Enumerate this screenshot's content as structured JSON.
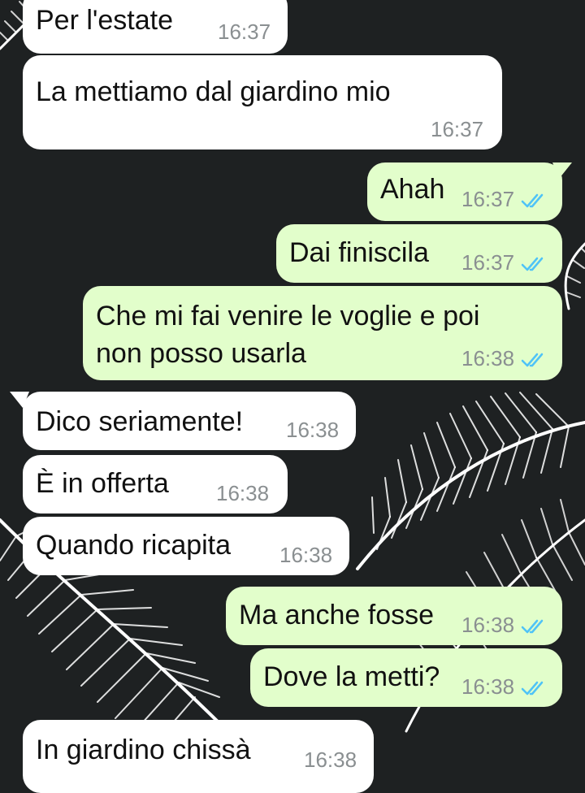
{
  "chat": {
    "messages": [
      {
        "dir": "in",
        "text": "Per l'estate",
        "time": "16:37"
      },
      {
        "dir": "in",
        "text": "La mettiamo dal giardino mio",
        "time": "16:37"
      },
      {
        "dir": "out",
        "text": "Ahah",
        "time": "16:37",
        "status": "read"
      },
      {
        "dir": "out",
        "text": "Dai finiscila",
        "time": "16:37",
        "status": "read"
      },
      {
        "dir": "out",
        "text": "Che mi fai venire le voglie e poi",
        "text2": "non posso usarla",
        "time": "16:38",
        "status": "read"
      },
      {
        "dir": "in",
        "text": "Dico seriamente!",
        "time": "16:38"
      },
      {
        "dir": "in",
        "text": "È in offerta",
        "time": "16:38"
      },
      {
        "dir": "in",
        "text": "Quando ricapita",
        "time": "16:38"
      },
      {
        "dir": "out",
        "text": "Ma anche fosse",
        "time": "16:38",
        "status": "read"
      },
      {
        "dir": "out",
        "text": "Dove la metti?",
        "time": "16:38",
        "status": "read"
      },
      {
        "dir": "in",
        "text": "In giardino chissà",
        "time": "16:38"
      }
    ]
  },
  "colors": {
    "background": "#1e2122",
    "incoming_bubble": "#ffffff",
    "outgoing_bubble": "#e2fecb",
    "read_ticks": "#4fc3f7",
    "time_text": "#8a8f91"
  },
  "icons": {
    "read_receipt": "double-check-icon"
  }
}
